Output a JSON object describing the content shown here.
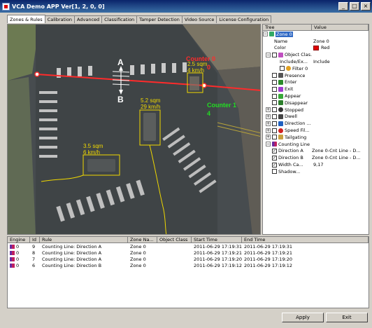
{
  "window": {
    "title": "VCA Demo APP Ver[1, 2, 0, 0]",
    "controls": [
      "_",
      "□",
      "×"
    ]
  },
  "tabs": [
    "Zones & Rules",
    "Calibration",
    "Advanced",
    "Classification",
    "Tamper Detection",
    "Video Source",
    "License Configuration"
  ],
  "video_overlay": {
    "label_a": "A",
    "label_b": "B",
    "counter0": "Counter 0",
    "counter0_value": "0",
    "counter1": "Counter 1",
    "counter1_value": "4",
    "objects": [
      {
        "area": "2.5 sqm",
        "speed": "4 km/h"
      },
      {
        "area": "5.2 sqm",
        "speed": "29 km/h"
      },
      {
        "area": "3.5 sqm",
        "speed": "6 km/h"
      }
    ]
  },
  "tree": {
    "header_tree": "Tree",
    "header_value": "Value",
    "rows": [
      {
        "label": "Zone 0",
        "value": ""
      },
      {
        "label": "Name",
        "value": "Zone 0"
      },
      {
        "label": "Color",
        "value": "Red"
      },
      {
        "label": "Object Clas...",
        "value": ""
      },
      {
        "label": "Include/Ex...",
        "value": "Include"
      },
      {
        "label": "Filter 0",
        "value": ""
      },
      {
        "label": "Presence",
        "value": ""
      },
      {
        "label": "Enter",
        "value": ""
      },
      {
        "label": "Exit",
        "value": ""
      },
      {
        "label": "Appear",
        "value": ""
      },
      {
        "label": "Disappear",
        "value": ""
      },
      {
        "label": "Stopped",
        "value": ""
      },
      {
        "label": "Dwell",
        "value": ""
      },
      {
        "label": "Direction ...",
        "value": ""
      },
      {
        "label": "Speed Fil...",
        "value": ""
      },
      {
        "label": "Tailgating",
        "value": ""
      },
      {
        "label": "Counting Line",
        "value": ""
      },
      {
        "label": "Direction A",
        "value": "Zone 0-Cnt Line - D..."
      },
      {
        "label": "Direction B",
        "value": "Zone 0-Cnt Line - D..."
      },
      {
        "label": "Width Ca...",
        "value": "9,17"
      },
      {
        "label": "Shadow...",
        "value": ""
      }
    ]
  },
  "events": {
    "headers": [
      "Engine",
      "Id",
      "Rule",
      "Zone Na...",
      "Object Class",
      "Start Time",
      "End Time"
    ],
    "rows": [
      {
        "engine": "0",
        "id": "9",
        "rule": "Counting Line: Direction A",
        "zone": "Zone 0",
        "object_class": "",
        "start": "2011-06-29 17:19:31",
        "end": "2011-06-29 17:19:31"
      },
      {
        "engine": "0",
        "id": "8",
        "rule": "Counting Line: Direction A",
        "zone": "Zone 0",
        "object_class": "",
        "start": "2011-06-29 17:19:21",
        "end": "2011-06-29 17:19:21"
      },
      {
        "engine": "0",
        "id": "7",
        "rule": "Counting Line: Direction A",
        "zone": "Zone 0",
        "object_class": "",
        "start": "2011-06-29 17:19:20",
        "end": "2011-06-29 17:19:20"
      },
      {
        "engine": "0",
        "id": "6",
        "rule": "Counting Line: Direction B",
        "zone": "Zone 0",
        "object_class": "",
        "start": "2011-06-29 17:19:12",
        "end": "2011-06-29 17:19:12"
      }
    ]
  },
  "buttons": {
    "apply": "Apply",
    "exit": "Exit"
  }
}
